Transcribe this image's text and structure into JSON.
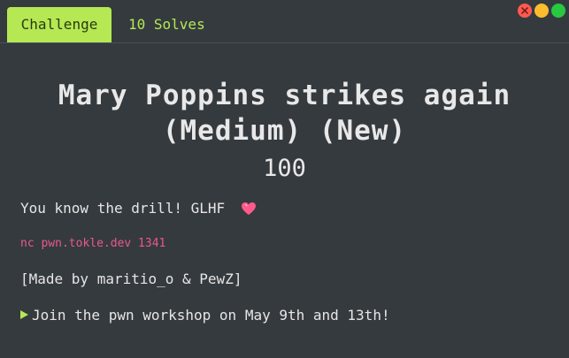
{
  "tabs": {
    "challenge_label": "Challenge",
    "solves_label": "10 Solves"
  },
  "challenge": {
    "title_line1": "Mary Poppins strikes again",
    "title_line2": "(Medium) (New)",
    "points": "100",
    "description_line1": "You know the drill! GLHF",
    "heart_icon": "heart-icon",
    "connection_command": "nc pwn.tokle.dev 1341",
    "credits": "[Made by maritio_o & PewZ]",
    "workshop_link": "Join the pwn workshop on May 9th and 13th!"
  },
  "colors": {
    "accent": "#b5e853",
    "background": "#353a3f",
    "command": "#e9598a",
    "heart": "#ff5a8a"
  }
}
